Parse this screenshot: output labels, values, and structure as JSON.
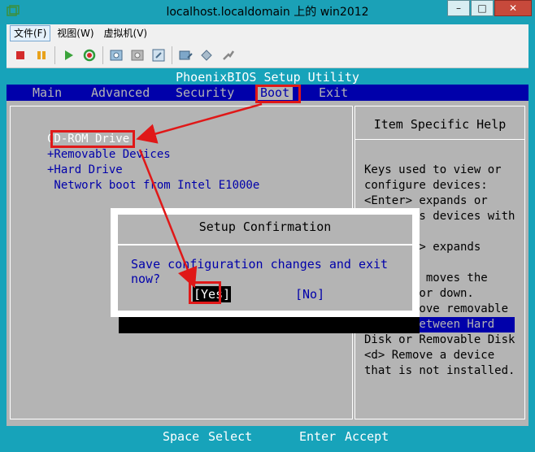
{
  "window": {
    "title": "localhost.localdomain 上的 win2012",
    "minimize_glyph": "–",
    "maximize_glyph": "□",
    "close_glyph": "✕"
  },
  "menubar": {
    "items": [
      {
        "label": "文件(F)"
      },
      {
        "label": "视图(W)"
      },
      {
        "label": "虚拟机(V)"
      }
    ]
  },
  "toolbar": {
    "icons": [
      "stop-icon",
      "pause-icon",
      "play-icon",
      "reset-icon",
      "snapshot-icon",
      "revert-snapshot-icon",
      "manage-snapshots-icon",
      "connect-cd-icon",
      "connect-floppy-icon",
      "settings-icon"
    ]
  },
  "bios": {
    "title": "PhoenixBIOS Setup Utility",
    "menus": [
      {
        "label": "Main"
      },
      {
        "label": "Advanced"
      },
      {
        "label": "Security"
      },
      {
        "label": "Boot"
      },
      {
        "label": "Exit"
      }
    ],
    "selected_menu": "Boot",
    "boot_items": [
      {
        "label": "CD-ROM Drive"
      },
      {
        "label": "+Removable Devices"
      },
      {
        "label": "+Hard Drive"
      },
      {
        "label": " Network boot from Intel E1000e"
      }
    ],
    "help": {
      "title": "Item Specific Help",
      "lines": [
        "Keys used to view or",
        "configure devices:",
        "<Enter> expands or",
        "        s devices with",
        "",
        "     ter> expands",
        "",
        "     <-> moves the",
        "        or down.",
        "        ove removable",
        "device between Hard",
        "Disk or Removable Disk",
        "<d> Remove a device",
        "that is not installed."
      ]
    },
    "footer": {
      "key1": "Space",
      "action1": "Select",
      "key2": "Enter",
      "action2": "Accept"
    }
  },
  "dialog": {
    "title": "Setup Confirmation",
    "message": "Save configuration changes and exit now?",
    "yes_label": "[Yes]",
    "no_label": "[No]"
  },
  "colors": {
    "bios_bg": "#b4b4b4",
    "bios_blue": "#0000aa",
    "bios_cyan": "#17a3ba",
    "annotation_red": "#e01818"
  }
}
